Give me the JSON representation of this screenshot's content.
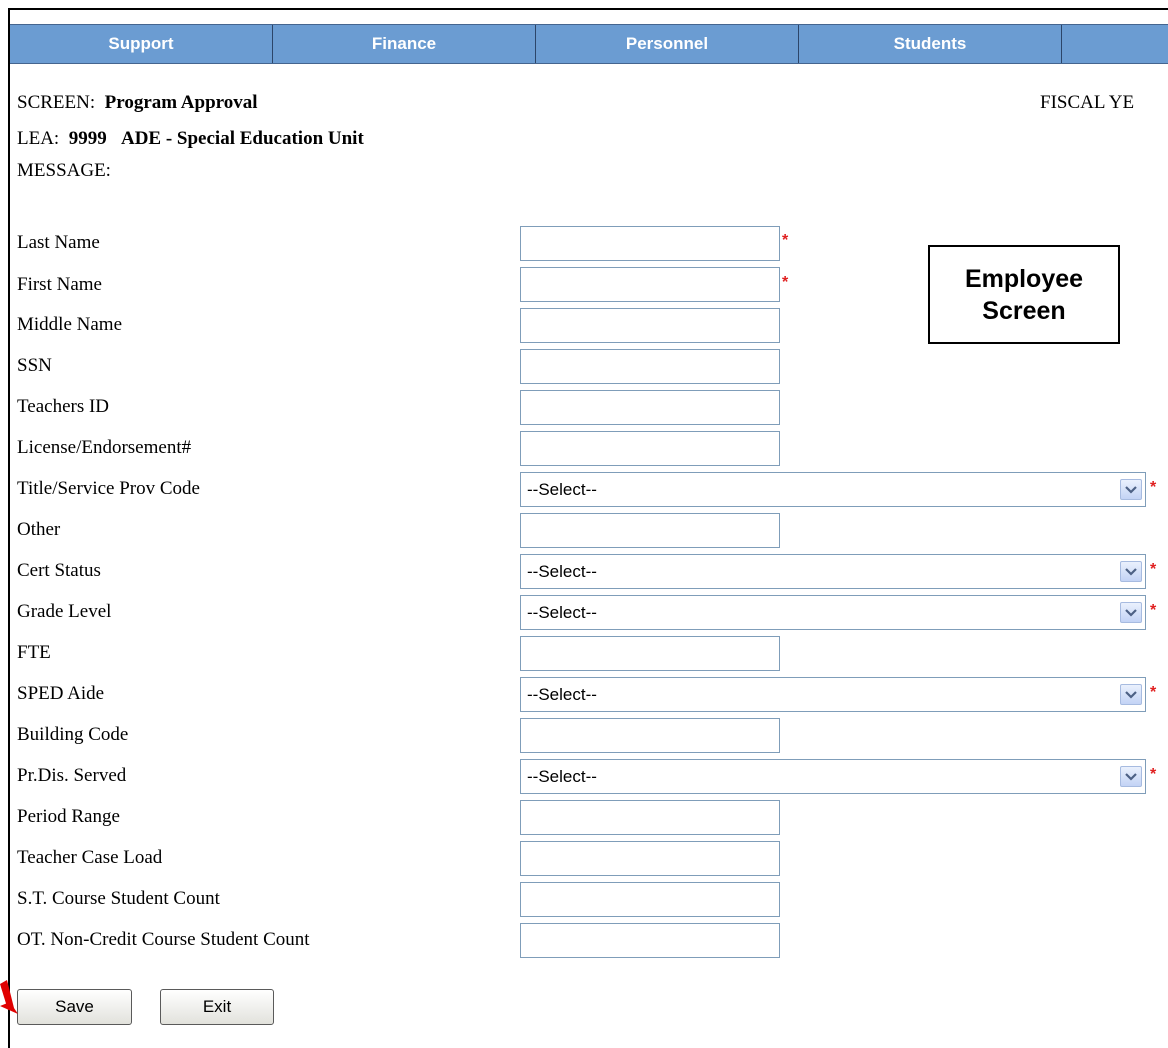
{
  "nav": {
    "items": [
      "Support",
      "Finance",
      "Personnel",
      "Students",
      ""
    ]
  },
  "header": {
    "screen_label": "SCREEN:",
    "screen_value": "Program Approval",
    "lea_label": "LEA:",
    "lea_code": "9999",
    "lea_name": "ADE - Special Education Unit",
    "message_label": "MESSAGE:",
    "fiscal_label": "FISCAL YE"
  },
  "callout": {
    "line1": "Employee",
    "line2": "Screen"
  },
  "form": {
    "last_name": "Last Name",
    "first_name": "First Name",
    "middle_name": "Middle Name",
    "ssn": "SSN",
    "teachers_id": "Teachers ID",
    "license": "License/Endorsement#",
    "title_service": "Title/Service Prov Code",
    "other": "Other",
    "cert_status": "Cert Status",
    "grade_level": "Grade Level",
    "fte": "FTE",
    "sped_aide": "SPED Aide",
    "building_code": "Building Code",
    "prdis_served": "Pr.Dis. Served",
    "period_range": "Period Range",
    "teacher_case_load": "Teacher Case Load",
    "st_course_count": "S.T. Course Student Count",
    "ot_noncredit_count": "OT. Non-Credit Course Student Count",
    "select_placeholder": "--Select--",
    "required_mark": "*"
  },
  "buttons": {
    "save": "Save",
    "exit": "Exit"
  },
  "colors": {
    "nav_bg": "#6b9cd2",
    "required": "#e02020",
    "annotation_arrow": "#e00000"
  }
}
